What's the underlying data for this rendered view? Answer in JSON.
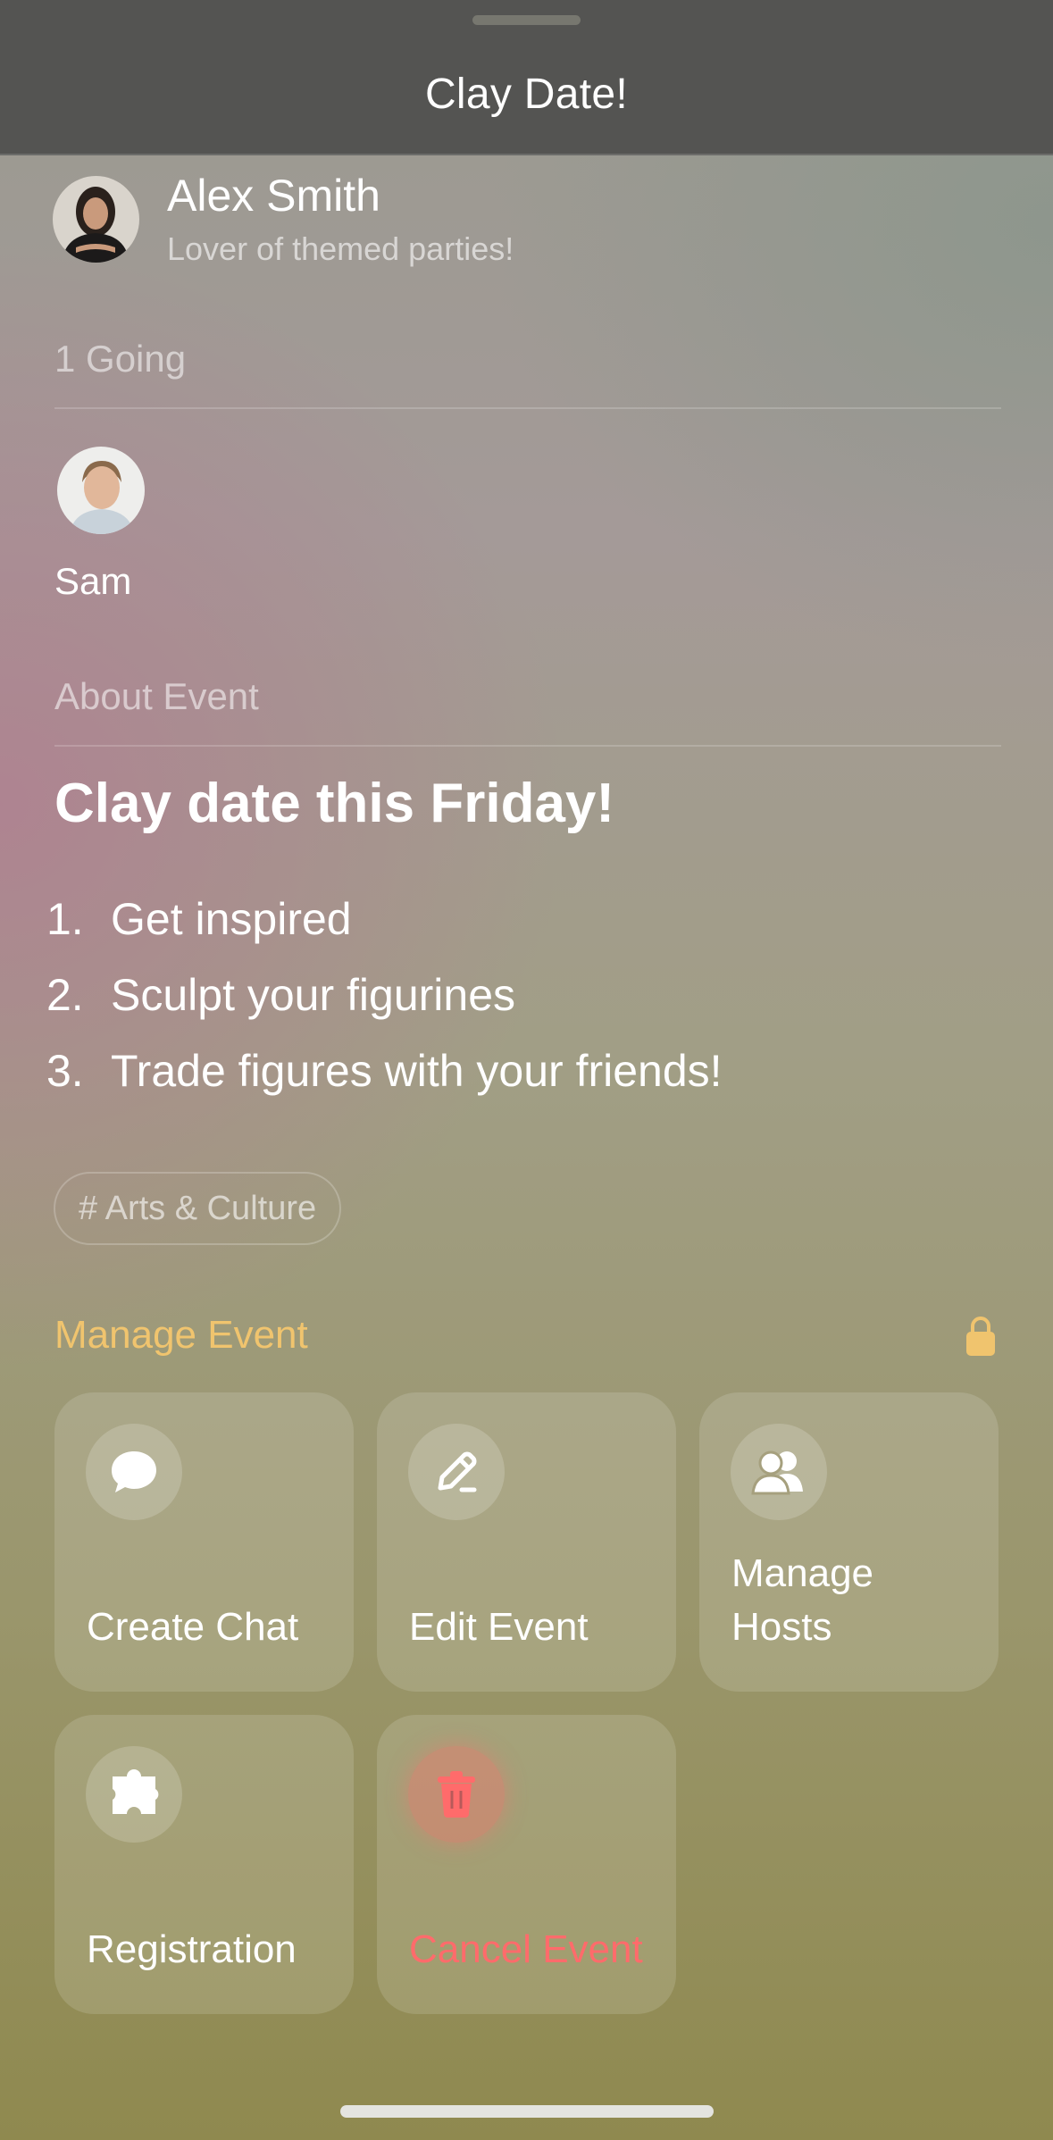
{
  "header": {
    "title": "Clay Date!"
  },
  "host": {
    "name": "Alex Smith",
    "bio": "Lover of themed parties!"
  },
  "going": {
    "label": "1 Going",
    "attendees": [
      {
        "name": "Sam"
      }
    ]
  },
  "about": {
    "label": "About Event",
    "title": "Clay date this Friday!",
    "steps": [
      {
        "num": "1.",
        "text": "Get inspired"
      },
      {
        "num": "2.",
        "text": "Sculpt your figurines"
      },
      {
        "num": "3.",
        "text": "Trade figures with your friends!"
      }
    ],
    "tag": "# Arts & Culture"
  },
  "manage": {
    "label": "Manage Event",
    "accent": "#f0c46e",
    "danger": "#ff6b6b",
    "lock_icon": "lock-icon",
    "actions": [
      {
        "label": "Create Chat",
        "icon": "chat-bubble-icon"
      },
      {
        "label": "Edit Event",
        "icon": "pencil-icon"
      },
      {
        "label": "Manage Hosts",
        "icon": "people-icon"
      },
      {
        "label": "Registration",
        "icon": "puzzle-icon"
      },
      {
        "label": "Cancel Event",
        "icon": "trash-icon"
      }
    ]
  }
}
